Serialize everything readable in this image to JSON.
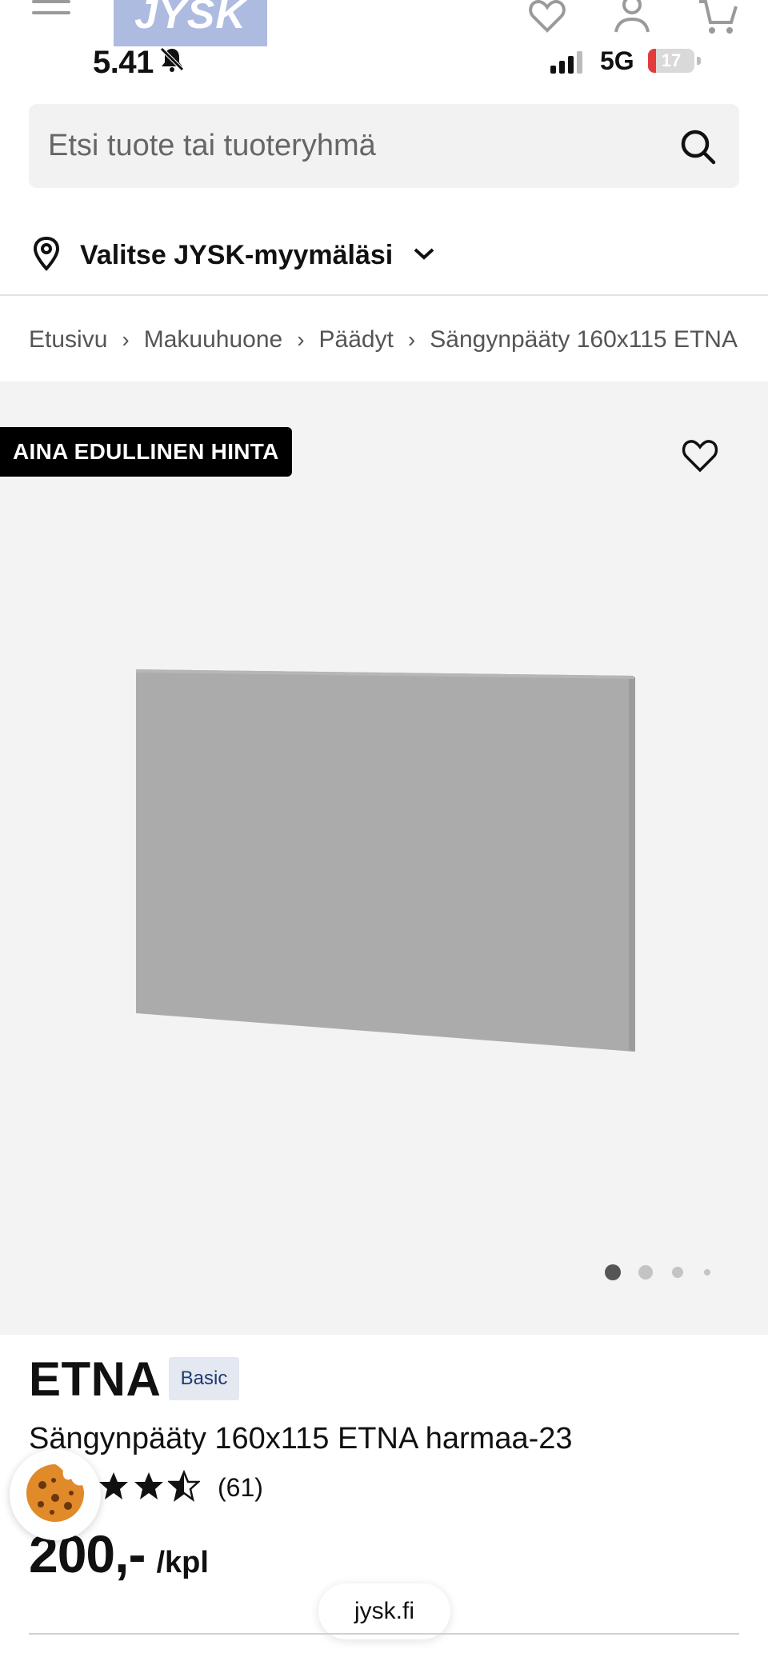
{
  "status_bar": {
    "time": "5.41",
    "network": "5G",
    "battery": "17",
    "battery_level": 0.17
  },
  "header": {
    "logo_text": "JYSK",
    "icons": [
      "menu-icon",
      "heart-icon",
      "user-icon",
      "cart-icon"
    ]
  },
  "search": {
    "placeholder": "Etsi tuote tai tuoteryhmä",
    "value": ""
  },
  "store_selector": {
    "label": "Valitse JYSK-myymäläsi"
  },
  "breadcrumb": {
    "items": [
      "Etusivu",
      "Makuuhuone",
      "Päädyt",
      "Sängynpääty 160x115 ETNA"
    ]
  },
  "gallery": {
    "promo_badge": "AINA EDULLINEN HINTA",
    "image_count": 4,
    "active_index": 0
  },
  "product": {
    "brand": "ETNA",
    "brand_badge": "Basic",
    "title": "Sängynpääty 160x115 ETNA harmaa-23",
    "rating": 3.5,
    "rating_max": 5,
    "review_count": "(61)",
    "price": "200,-",
    "unit": "/kpl"
  },
  "browser": {
    "url": "jysk.fi"
  },
  "colors": {
    "battery_low": "#e33b3b",
    "logo_bg": "#aebbe0",
    "badge_bg": "#000000",
    "basic_badge_bg": "#e3e8f1",
    "basic_badge_text": "#1f3b70",
    "gallery_bg": "#f3f3f3",
    "headboard": "#a9a9a9"
  }
}
